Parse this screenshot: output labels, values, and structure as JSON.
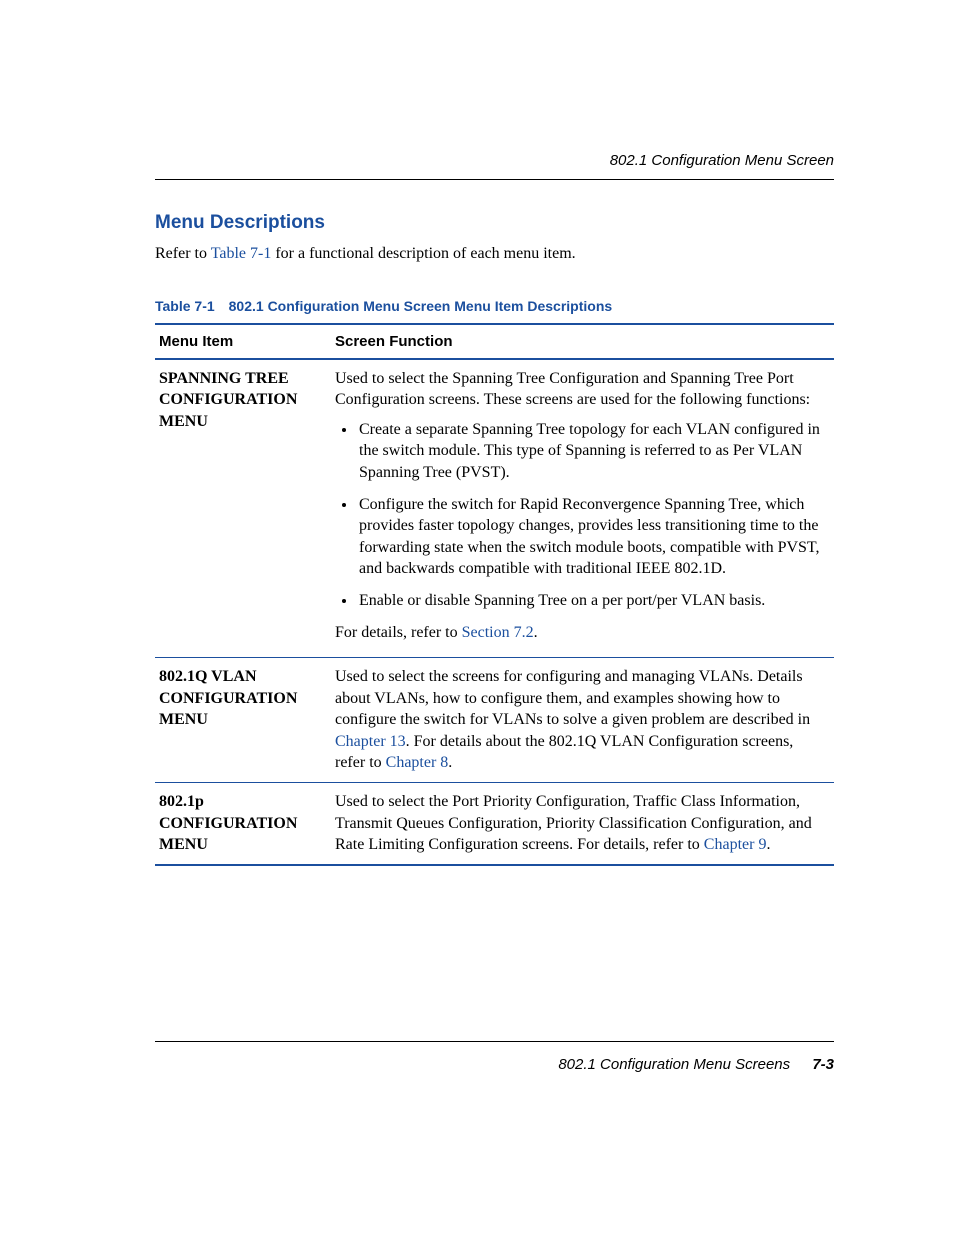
{
  "header": {
    "title": "802.1 Configuration Menu Screen"
  },
  "section": {
    "heading": "Menu Descriptions",
    "intro_before": "Refer to ",
    "intro_link": "Table 7-1",
    "intro_after": " for a functional description of each menu item."
  },
  "table": {
    "caption": "Table 7-1 802.1 Configuration Menu Screen Menu Item Descriptions",
    "head": {
      "col1": "Menu Item",
      "col2": "Screen Function"
    },
    "rows": [
      {
        "menuitem": "SPANNING TREE CONFIGURATION MENU",
        "desc_intro": "Used to select the Spanning Tree Configuration and Spanning Tree Port Configuration screens. These screens are used for the following functions:",
        "bullets": [
          "Create a separate Spanning Tree topology for each VLAN configured in the switch module. This type of Spanning is referred to as Per VLAN Spanning Tree (PVST).",
          "Configure the switch for Rapid Reconvergence Spanning Tree, which provides faster topology changes, provides less transitioning time to the forwarding state when the switch module boots, compatible with PVST, and backwards compatible with traditional IEEE 802.1D.",
          "Enable or disable Spanning Tree on a per port/per VLAN basis."
        ],
        "desc_outro_before": "For details, refer to ",
        "desc_outro_link": "Section 7.2",
        "desc_outro_after": "."
      },
      {
        "menuitem": "802.1Q VLAN CONFIGURATION MENU",
        "desc_before": "Used to select the screens for configuring and managing VLANs. Details about VLANs, how to configure them, and examples showing how to configure the switch for VLANs to solve a given problem are described in ",
        "link1": "Chapter 13",
        "desc_mid": ". For details about the 802.1Q VLAN Configuration screens, refer to ",
        "link2": "Chapter 8",
        "desc_after": "."
      },
      {
        "menuitem": "802.1p CONFIGURATION MENU",
        "desc_before": "Used to select the Port Priority Configuration, Traffic Class Information, Transmit Queues Configuration, Priority Classification Configuration, and Rate Limiting Configuration screens. For details, refer to ",
        "link1": "Chapter 9",
        "desc_after": "."
      }
    ]
  },
  "footer": {
    "text": "802.1 Configuration Menu Screens",
    "pageno": "7-3"
  }
}
